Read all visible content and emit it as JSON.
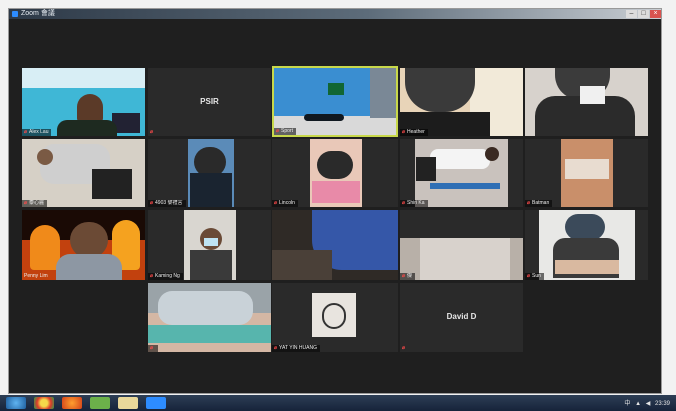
{
  "window": {
    "title": "Zoom 會議"
  },
  "participants": [
    {
      "id": "t1",
      "name": "Alex Lau",
      "muted": true
    },
    {
      "id": "t2",
      "name": "PSIR",
      "muted": true
    },
    {
      "id": "t3",
      "name": "Sport",
      "muted": true,
      "speaking": true
    },
    {
      "id": "t4",
      "name": "Heather",
      "muted": true
    },
    {
      "id": "t5",
      "name": "",
      "muted": false
    },
    {
      "id": "t6",
      "name": "泰心麗",
      "muted": true
    },
    {
      "id": "t7",
      "name": "4903 黎禮言",
      "muted": true
    },
    {
      "id": "t8",
      "name": "Lincoln",
      "muted": true
    },
    {
      "id": "t9",
      "name": "Shiri Ka",
      "muted": true
    },
    {
      "id": "t10",
      "name": "Batman",
      "muted": true
    },
    {
      "id": "t11",
      "name": "Penny Lim",
      "muted": false
    },
    {
      "id": "t12",
      "name": "Kaming Ng",
      "muted": true
    },
    {
      "id": "t13",
      "name": "",
      "muted": false
    },
    {
      "id": "t14",
      "name": "傑",
      "muted": true
    },
    {
      "id": "t15",
      "name": "Sun",
      "muted": true
    },
    {
      "id": "t16",
      "name": "",
      "muted": true
    },
    {
      "id": "t17",
      "name": "YAT YIN HUANG",
      "muted": true
    },
    {
      "id": "t18",
      "name": "David D",
      "muted": true
    }
  ],
  "taskbar": {
    "time": "23:39",
    "ime": "中"
  },
  "colors": {
    "speaking_border": "#c8d84a",
    "mute_icon": "#ff4b4b",
    "window_bg": "#1f1f1f"
  }
}
